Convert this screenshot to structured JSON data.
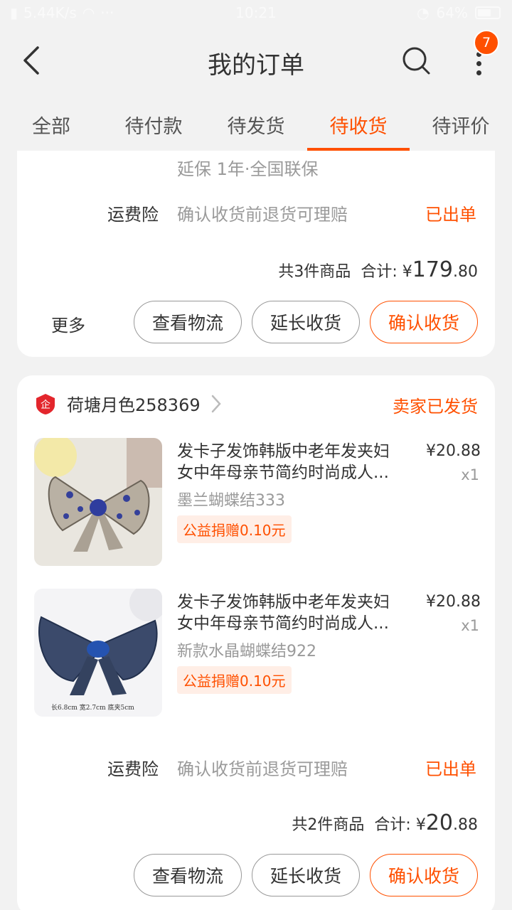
{
  "status_bar": {
    "network": "5.44K/s",
    "time": "10:21",
    "battery": "64%"
  },
  "header": {
    "title": "我的订单",
    "badge_count": "7"
  },
  "tabs": [
    {
      "label": "全部",
      "active": false
    },
    {
      "label": "待付款",
      "active": false
    },
    {
      "label": "待发货",
      "active": false
    },
    {
      "label": "待收货",
      "active": true
    },
    {
      "label": "待评价",
      "active": false
    }
  ],
  "order1": {
    "warranty": "延保 1年·全国联保",
    "insurance_label": "运费险",
    "insurance_text": "确认收货前退货可理赔",
    "insurance_status": "已出单",
    "count_text": "共3件商品",
    "total_label": "合计:",
    "total_currency": "¥",
    "total_int": "179",
    "total_dec": ".80",
    "more_label": "更多",
    "btn_logistics": "查看物流",
    "btn_extend": "延长收货",
    "btn_confirm": "确认收货"
  },
  "order2": {
    "shop_name": "荷塘月色258369",
    "shop_status": "卖家已发货",
    "items": [
      {
        "title": "发卡子发饰韩版中老年发夹妇女中年母亲节简约时尚成人...",
        "sku": "墨兰蝴蝶结333",
        "tag": "公益捐赠0.10元",
        "price": "¥20.88",
        "qty": "x1"
      },
      {
        "title": "发卡子发饰韩版中老年发夹妇女中年母亲节简约时尚成人...",
        "sku": "新款水晶蝴蝶结922",
        "tag": "公益捐赠0.10元",
        "price": "¥20.88",
        "qty": "x1",
        "image_caption": "长6.8cm  宽2.7cm  底夹5cm"
      }
    ],
    "insurance_label": "运费险",
    "insurance_text": "确认收货前退货可理赔",
    "insurance_status": "已出单",
    "count_text": "共2件商品",
    "total_label": "合计:",
    "total_currency": "¥",
    "total_int": "20",
    "total_dec": ".88",
    "btn_logistics": "查看物流",
    "btn_extend": "延长收货",
    "btn_confirm": "确认收货"
  },
  "colors": {
    "accent": "#ff5000",
    "background": "#f2f2f2"
  }
}
